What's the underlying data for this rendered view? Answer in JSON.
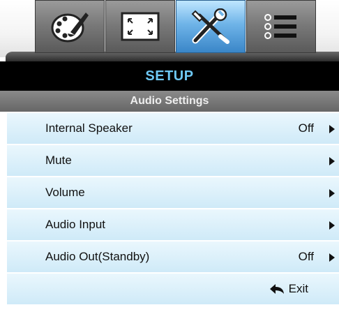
{
  "tabs": [
    {
      "icon": "palette-icon",
      "active": false
    },
    {
      "icon": "screen-resize-icon",
      "active": false
    },
    {
      "icon": "tools-icon",
      "active": true
    },
    {
      "icon": "list-icon",
      "active": false
    }
  ],
  "header": {
    "title": "SETUP"
  },
  "subheader": {
    "title": "Audio Settings"
  },
  "menu": {
    "items": [
      {
        "label": "Internal Speaker",
        "value": "Off"
      },
      {
        "label": "Mute",
        "value": ""
      },
      {
        "label": "Volume",
        "value": ""
      },
      {
        "label": "Audio Input",
        "value": ""
      },
      {
        "label": "Audio Out(Standby)",
        "value": "Off"
      }
    ]
  },
  "footer": {
    "exit_label": "Exit",
    "exit_icon": "return-arrow-icon"
  },
  "colors": {
    "accent": "#6ec8f4",
    "row_bg": "#cfeaf8",
    "header_bg": "#000000"
  }
}
